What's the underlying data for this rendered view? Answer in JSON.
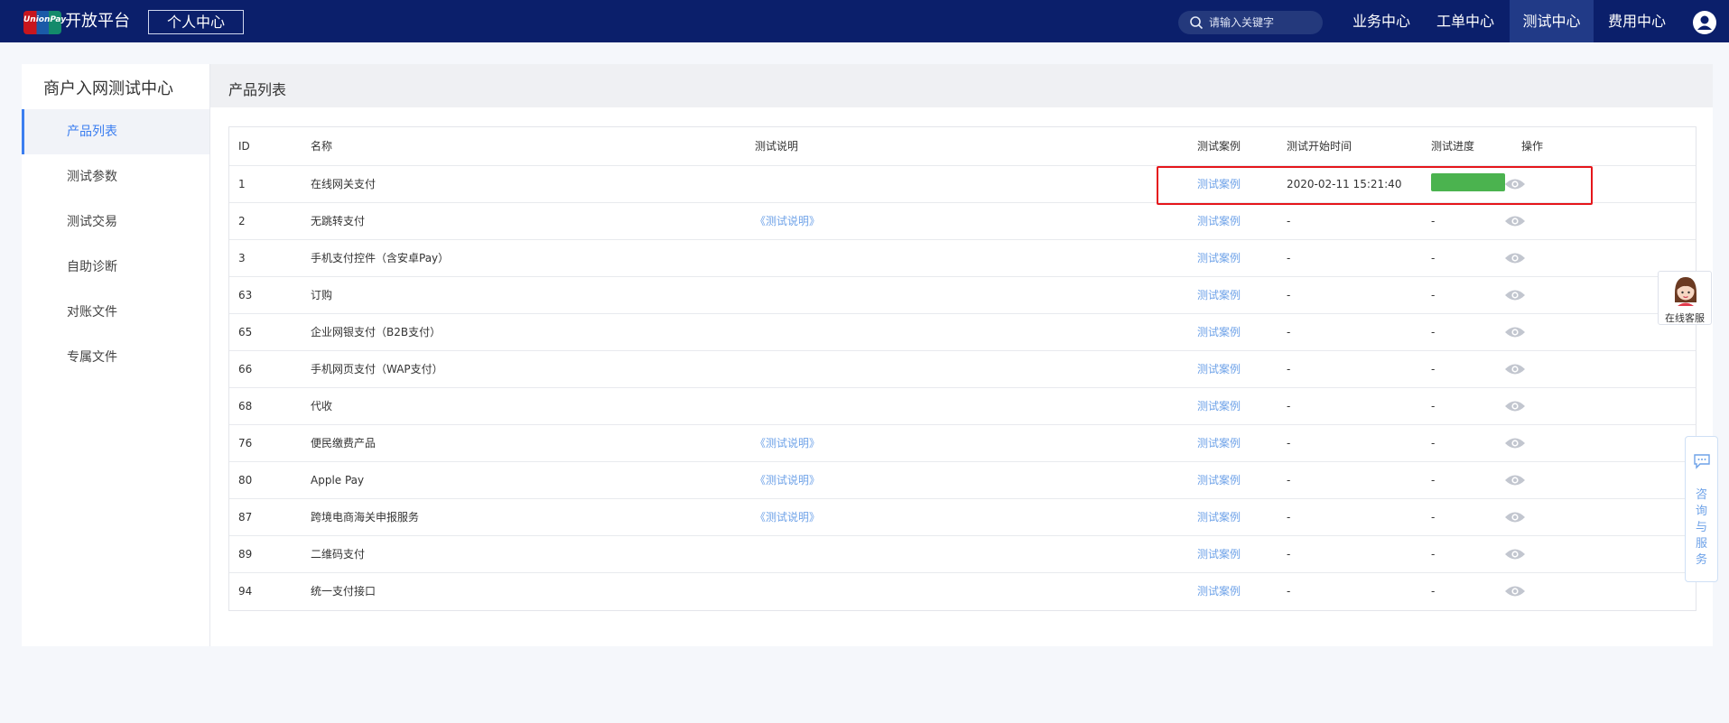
{
  "topbar": {
    "logo_text": "UnionPay",
    "brand": "开放平台",
    "personal_center": "个人中心",
    "search_placeholder": "请输入关键字",
    "nav": [
      "业务中心",
      "工单中心",
      "测试中心",
      "费用中心"
    ],
    "active_nav": "测试中心"
  },
  "sidebar": {
    "title": "商户入网测试中心",
    "items": [
      "产品列表",
      "测试参数",
      "测试交易",
      "自助诊断",
      "对账文件",
      "专属文件"
    ],
    "active": "产品列表"
  },
  "main": {
    "title": "产品列表",
    "columns": [
      "ID",
      "名称",
      "测试说明",
      "测试案例",
      "测试开始时间",
      "测试进度",
      "操作"
    ],
    "rows": [
      {
        "id": "1",
        "name": "在线网关支付",
        "note": "",
        "case": "测试案例",
        "start": "2020-02-11 15:21:40",
        "progress": "",
        "progress_pct": 100
      },
      {
        "id": "2",
        "name": "无跳转支付",
        "note": "《测试说明》",
        "case": "测试案例",
        "start": "-",
        "progress": "-"
      },
      {
        "id": "3",
        "name": "手机支付控件（含安卓Pay）",
        "note": "",
        "case": "测试案例",
        "start": "-",
        "progress": "-"
      },
      {
        "id": "63",
        "name": "订购",
        "note": "",
        "case": "测试案例",
        "start": "-",
        "progress": "-"
      },
      {
        "id": "65",
        "name": "企业网银支付（B2B支付）",
        "note": "",
        "case": "测试案例",
        "start": "-",
        "progress": "-"
      },
      {
        "id": "66",
        "name": "手机网页支付（WAP支付）",
        "note": "",
        "case": "测试案例",
        "start": "-",
        "progress": "-"
      },
      {
        "id": "68",
        "name": "代收",
        "note": "",
        "case": "测试案例",
        "start": "-",
        "progress": "-"
      },
      {
        "id": "76",
        "name": "便民缴费产品",
        "note": "《测试说明》",
        "case": "测试案例",
        "start": "-",
        "progress": "-"
      },
      {
        "id": "80",
        "name": "Apple Pay",
        "note": "《测试说明》",
        "case": "测试案例",
        "start": "-",
        "progress": "-"
      },
      {
        "id": "87",
        "name": "跨境电商海关申报服务",
        "note": "《测试说明》",
        "case": "测试案例",
        "start": "-",
        "progress": "-"
      },
      {
        "id": "89",
        "name": "二维码支付",
        "note": "",
        "case": "测试案例",
        "start": "-",
        "progress": "-"
      },
      {
        "id": "94",
        "name": "统一支付接口",
        "note": "",
        "case": "测试案例",
        "start": "-",
        "progress": "-"
      }
    ]
  },
  "widgets": {
    "online_service": "在线客服",
    "consult": "咨询与服务"
  },
  "colors": {
    "topbar": "#0b1f6b",
    "accent": "#3b7ef0",
    "link": "#6ea2e8",
    "progress": "#4bb34f",
    "highlight": "#e5161b"
  }
}
